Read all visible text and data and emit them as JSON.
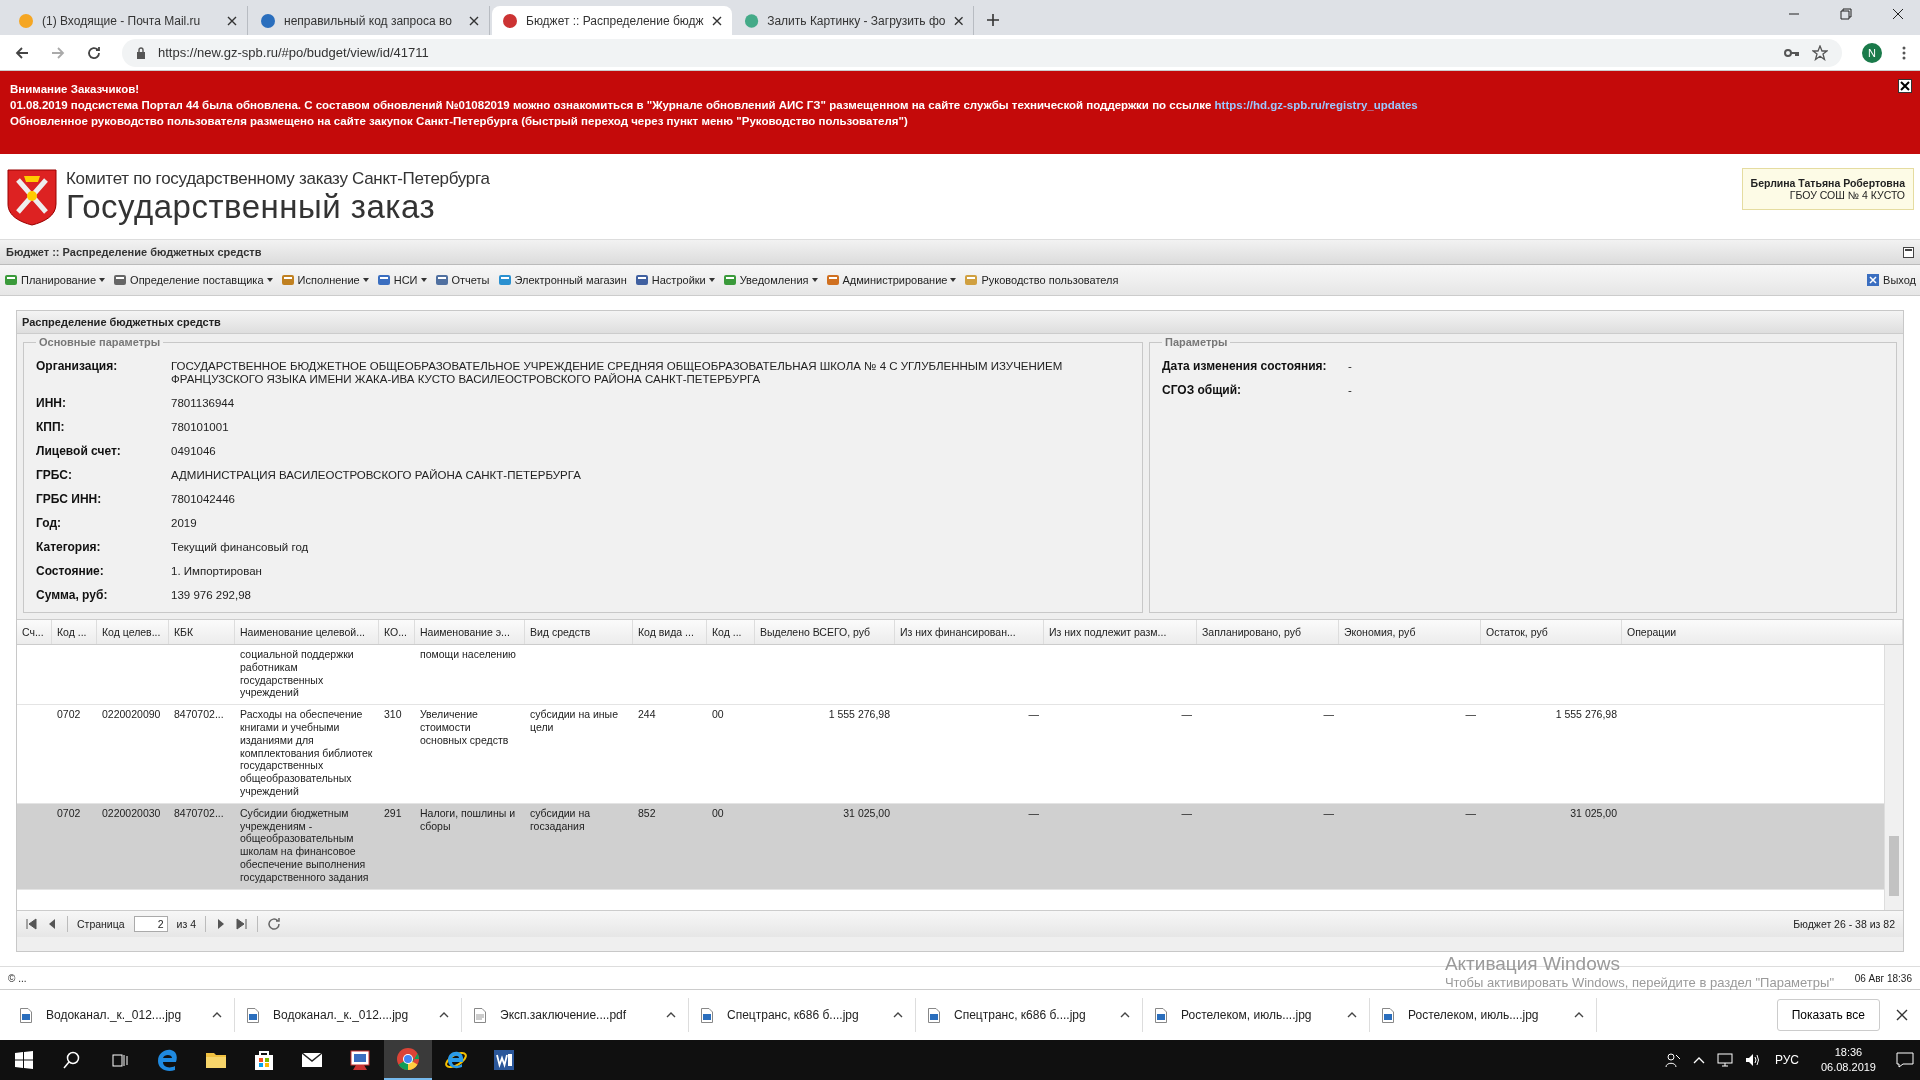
{
  "browser": {
    "tabs": [
      {
        "title": "(1) Входящие - Почта Mail.ru",
        "selected": false
      },
      {
        "title": "неправильный код запроса во",
        "selected": false
      },
      {
        "title": "Бюджет :: Распределение бюдж",
        "selected": true
      },
      {
        "title": "Залить Картинку - Загрузить фо",
        "selected": false
      }
    ],
    "url": "https://new.gz-spb.ru/#po/budget/view/id/41711",
    "profile": "N"
  },
  "notice": {
    "title": "Внимание Заказчиков!",
    "line1": "01.08.2019 подсистема Портал 44 была обновлена. С составом обновлений №01082019 можно ознакомиться в \"Журнале обновлений АИС ГЗ\" размещенном на сайте службы технической поддержки по ссылке",
    "link": "https://hd.gz-spb.ru/registry_updates",
    "line2": "Обновленное руководство пользователя размещено на сайте закупок Санкт-Петербурга (быстрый переход через пункт меню \"Руководство пользователя\")"
  },
  "header": {
    "subtitle": "Комитет по государственному заказу Санкт-Петербурга",
    "title": "Государственный заказ",
    "user": {
      "name": "Берлина Татьяна Робертовна",
      "org": "ГБОУ СОШ № 4 КУСТО"
    }
  },
  "page_title": "Бюджет :: Распределение бюджетных средств",
  "menu": [
    {
      "label": "Планирование",
      "dropdown": true
    },
    {
      "label": "Определение поставщика",
      "dropdown": true
    },
    {
      "label": "Исполнение",
      "dropdown": true
    },
    {
      "label": "НСИ",
      "dropdown": true
    },
    {
      "label": "Отчеты",
      "dropdown": false
    },
    {
      "label": "Электронный магазин",
      "dropdown": false
    },
    {
      "label": "Настройки",
      "dropdown": true
    },
    {
      "label": "Уведомления",
      "dropdown": true
    },
    {
      "label": "Администрирование",
      "dropdown": true
    },
    {
      "label": "Руководство пользователя",
      "dropdown": false
    }
  ],
  "exit": "Выход",
  "panel": {
    "title": "Распределение бюджетных средств",
    "main": {
      "legend": "Основные параметры",
      "fields": [
        {
          "label": "Организация:",
          "value": "ГОСУДАРСТВЕННОЕ БЮДЖЕТНОЕ ОБЩЕОБРАЗОВАТЕЛЬНОЕ УЧРЕЖДЕНИЕ СРЕДНЯЯ ОБЩЕОБРАЗОВАТЕЛЬНАЯ ШКОЛА № 4 С УГЛУБЛЕННЫМ ИЗУЧЕНИЕМ ФРАНЦУЗСКОГО ЯЗЫКА ИМЕНИ ЖАКА-ИВА КУСТО ВАСИЛЕОСТРОВСКОГО РАЙОНА САНКТ-ПЕТЕРБУРГА"
        },
        {
          "label": "ИНН:",
          "value": "7801136944"
        },
        {
          "label": "КПП:",
          "value": "780101001"
        },
        {
          "label": "Лицевой счет:",
          "value": "0491046"
        },
        {
          "label": "ГРБС:",
          "value": "АДМИНИСТРАЦИЯ ВАСИЛЕОСТРОВСКОГО РАЙОНА САНКТ-ПЕТЕРБУРГА"
        },
        {
          "label": "ГРБС ИНН:",
          "value": "7801042446"
        },
        {
          "label": "Год:",
          "value": "2019"
        },
        {
          "label": "Категория:",
          "value": "Текущий финансовый год"
        },
        {
          "label": "Состояние:",
          "value": "1. Импортирован"
        },
        {
          "label": "Сумма, руб:",
          "value": "139 976 292,98"
        }
      ]
    },
    "params": {
      "legend": "Параметры",
      "fields": [
        {
          "label": "Дата изменения состояния:",
          "value": "-"
        },
        {
          "label": "СГОЗ общий:",
          "value": "-"
        }
      ]
    }
  },
  "table": {
    "columns": [
      "Сч...",
      "Код ...",
      "Код целев...",
      "КБК",
      "Наименование целевой...",
      "КО...",
      "Наименование э...",
      "Вид средств",
      "Код вида ...",
      "Код ...",
      "Выделено ВСЕГО, руб",
      "Из них финансирован...",
      "Из них подлежит разм...",
      "Запланировано, руб",
      "Экономия, руб",
      "Остаток, руб",
      "Операции"
    ],
    "rows": [
      {
        "selected": false,
        "cells": [
          null,
          null,
          null,
          null,
          "социальной поддержки работникам государственных учреждений",
          null,
          "помощи населению",
          null,
          null,
          null,
          null,
          null,
          null,
          null,
          null,
          null,
          null
        ]
      },
      {
        "selected": false,
        "cells": [
          null,
          "0702",
          "0220020090",
          "8470702...",
          "Расходы на обеспечение книгами и учебными изданиями для комплектования библиотек государственных общеобразовательных учреждений",
          "310",
          "Увеличение стоимости основных средств",
          "субсидии на иные цели",
          "244",
          "00",
          "1 555 276,98",
          "—",
          "—",
          "—",
          "—",
          "1 555 276,98",
          null
        ]
      },
      {
        "selected": true,
        "cells": [
          null,
          "0702",
          "0220020030",
          "8470702...",
          "Субсидии бюджетным учреждениям - общеобразовательным школам на финансовое обеспечение выполнения государственного задания",
          "291",
          "Налоги, пошлины и сборы",
          "субсидии на госзадания",
          "852",
          "00",
          "31 025,00",
          "—",
          "—",
          "—",
          "—",
          "31 025,00",
          null
        ]
      }
    ]
  },
  "pager": {
    "label": "Страница",
    "page": "2",
    "of": "из 4",
    "summary": "Бюджет 26 - 38 из 82"
  },
  "status": {
    "left": "© ...",
    "right": "06 Авг 18:36"
  },
  "activation": {
    "title": "Активация Windows",
    "text": "Чтобы активировать Windows, перейдите в раздел \"Параметры\""
  },
  "downloads": {
    "files": [
      {
        "name": "Водоканал._к._012....jpg",
        "kind": "image"
      },
      {
        "name": "Водоканал._к._012....jpg",
        "kind": "image"
      },
      {
        "name": "Эксп.заключение....pdf",
        "kind": "document"
      },
      {
        "name": "Спецтранс, к686 б....jpg",
        "kind": "image"
      },
      {
        "name": "Спецтранс, к686 б....jpg",
        "kind": "image"
      },
      {
        "name": "Ростелеком, июль....jpg",
        "kind": "image"
      },
      {
        "name": "Ростелеком, июль....jpg",
        "kind": "image"
      }
    ],
    "show_all": "Показать все"
  },
  "taskbar": {
    "apps": [
      {
        "kind": "edge",
        "selected": false
      },
      {
        "kind": "folder",
        "selected": false
      },
      {
        "kind": "store",
        "selected": false
      },
      {
        "kind": "mail",
        "selected": false
      },
      {
        "kind": "app",
        "selected": false
      },
      {
        "kind": "chrome",
        "selected": true
      },
      {
        "kind": "ie",
        "selected": false
      },
      {
        "kind": "word",
        "selected": false
      }
    ],
    "lang": "РУС",
    "time": "18:36",
    "date": "06.08.2019"
  }
}
